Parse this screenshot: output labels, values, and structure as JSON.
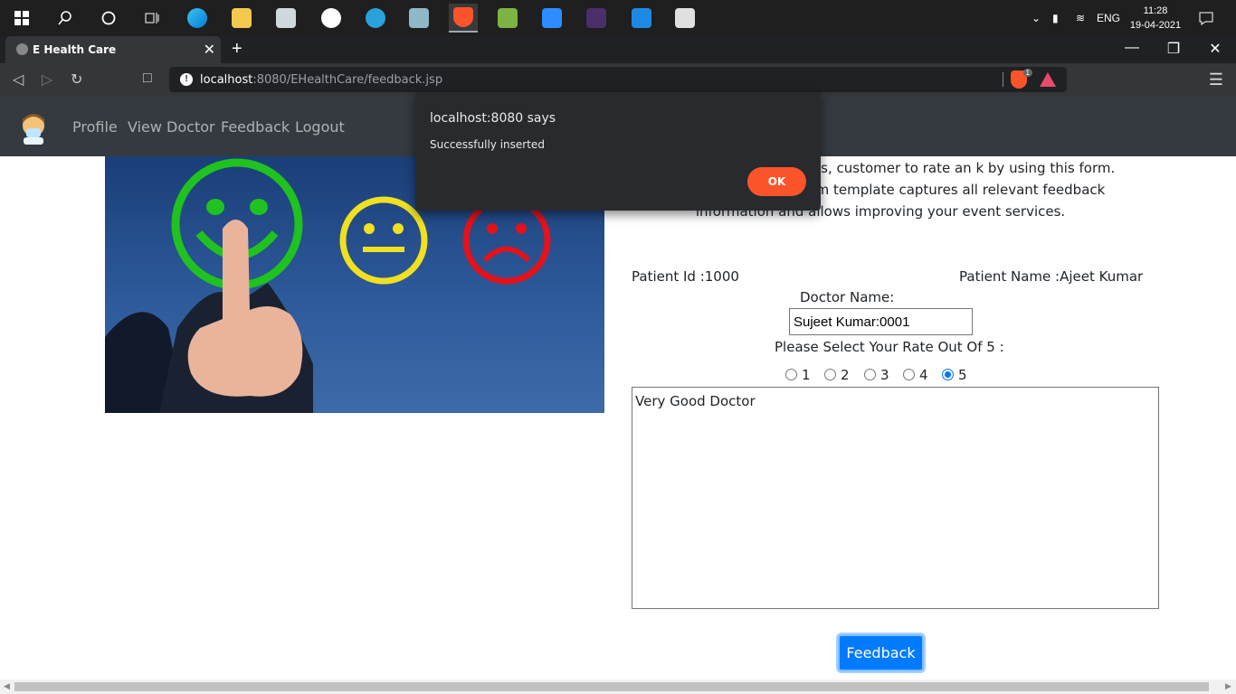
{
  "taskbar": {
    "language": "ENG",
    "time": "11:28",
    "date": "19-04-2021"
  },
  "browser": {
    "tab_title": "E Health Care",
    "url_host": "localhost",
    "url_rest": ":8080/EHealthCare/feedback.jsp",
    "shield_count": "1"
  },
  "site": {
    "nav": [
      "Profile",
      "View Doctor",
      "Feedback",
      "Logout"
    ]
  },
  "page": {
    "intro": "or any type of user, clients, customer to rate an k by using this form. This event feedback form template captures all relevant feedback information and allows improving your event services.",
    "patient_id": "Patient Id :1000",
    "patient_name": "Patient Name :Ajeet Kumar",
    "doctor_label": "Doctor Name:",
    "doctor_value": "Sujeet Kumar:0001",
    "rate_label": "Please Select Your Rate Out Of 5 :",
    "rates": [
      "1",
      "2",
      "3",
      "4",
      "5"
    ],
    "selected_rate": "5",
    "comment": "Very Good Doctor",
    "submit_label": "Feedback"
  },
  "dialog": {
    "title": "localhost:8080 says",
    "message": "Successfully inserted",
    "ok_label": "OK"
  }
}
